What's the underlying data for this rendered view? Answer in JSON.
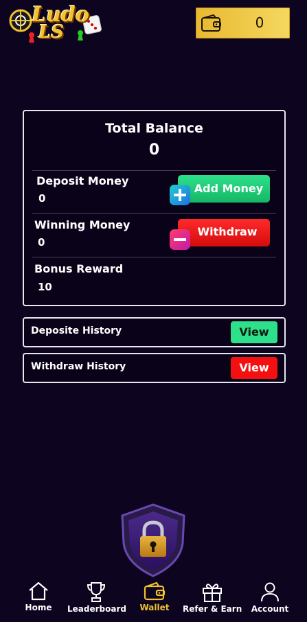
{
  "header": {
    "logo_text_line1": "Ludo",
    "logo_text_line2": "LS",
    "wallet_balance": "0"
  },
  "balance_card": {
    "total_label": "Total Balance",
    "total_value": "0",
    "deposit_label": "Deposit Money",
    "deposit_value": "0",
    "add_money_label": "Add Money",
    "winning_label": "Winning Money",
    "winning_value": "0",
    "withdraw_label": "Withdraw",
    "bonus_label": "Bonus Reward",
    "bonus_value": "10"
  },
  "history": {
    "deposit_label": "Deposite History",
    "deposit_view": "View",
    "withdraw_label": "Withdraw History",
    "withdraw_view": "View"
  },
  "nav": {
    "items": [
      {
        "label": "Home",
        "icon": "home-icon",
        "active": false
      },
      {
        "label": "Leaderboard",
        "icon": "trophy-icon",
        "active": false
      },
      {
        "label": "Wallet",
        "icon": "wallet-icon",
        "active": true
      },
      {
        "label": "Refer & Earn",
        "icon": "gift-icon",
        "active": false
      },
      {
        "label": "Account",
        "icon": "user-icon",
        "active": false
      }
    ]
  },
  "colors": {
    "background": "#0d0420",
    "accent_gold": "#f2c230",
    "green": "#2ee08a",
    "red": "#f41010",
    "active_nav": "#f2c230"
  }
}
